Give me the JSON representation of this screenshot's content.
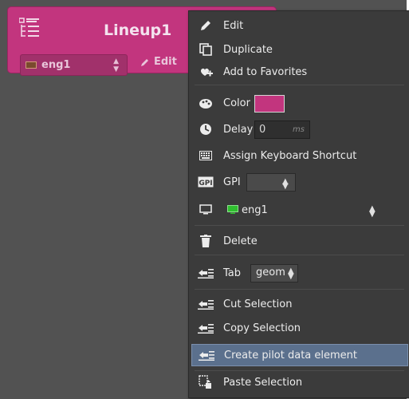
{
  "card": {
    "title": "Lineup1",
    "engine_label": "eng1",
    "edit_label": "Edit",
    "color": "#c2357e"
  },
  "menu": {
    "edit": "Edit",
    "duplicate": "Duplicate",
    "add_favorites": "Add to Favorites",
    "color_label": "Color",
    "color_value": "#c2357e",
    "delay_label": "Delay",
    "delay_value": "0",
    "delay_unit": "ms",
    "assign_shortcut": "Assign Keyboard Shortcut",
    "gpi_label": "GPI",
    "gpi_icon_text": "GPI",
    "engine_value": "eng1",
    "delete": "Delete",
    "tab_label": "Tab",
    "tab_value": "geom",
    "cut_selection": "Cut Selection",
    "copy_selection": "Copy Selection",
    "create_pilot": "Create pilot data element",
    "paste_selection": "Paste Selection"
  },
  "icons": {
    "edit": "pencil-icon",
    "duplicate": "duplicate-icon",
    "favorites": "add-favorites-icon",
    "color": "palette-icon",
    "delay": "clock-icon",
    "keyboard": "keyboard-icon",
    "gpi": "gpi-icon",
    "monitor": "monitor-icon",
    "delete": "trash-icon",
    "tab": "indent-icon",
    "cut": "indent-icon",
    "copy": "indent-icon",
    "create": "indent-icon",
    "paste": "paste-icon"
  },
  "colors": {
    "accent": "#c2357e",
    "menu_bg": "#3b3b3b",
    "highlight": "#5b708d",
    "engine_green": "#2fbf2f"
  }
}
